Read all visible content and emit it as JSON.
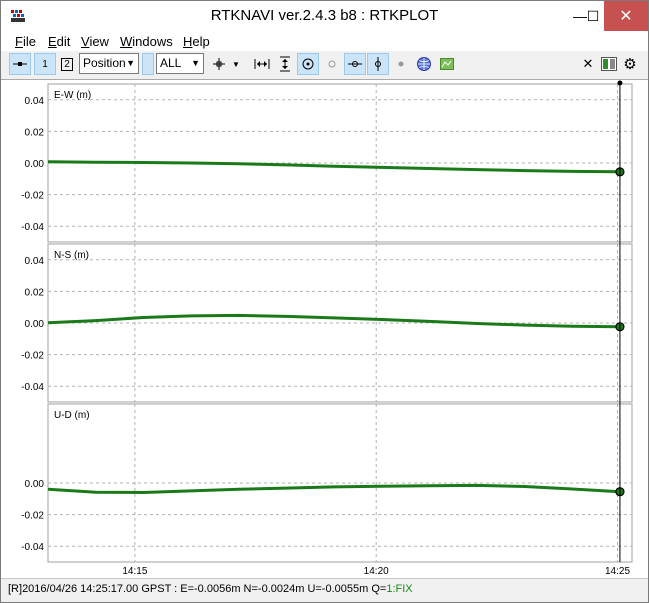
{
  "window": {
    "title": "RTKNAVI ver.2.4.3 b8 : RTKPLOT",
    "minimize_glyph": "—",
    "maximize_glyph": "☐",
    "close_glyph": "✕"
  },
  "menu": [
    {
      "label": "File",
      "accel": "F",
      "rest": "ile"
    },
    {
      "label": "Edit",
      "accel": "E",
      "rest": "dit"
    },
    {
      "label": "View",
      "accel": "V",
      "rest": "iew"
    },
    {
      "label": "Windows",
      "accel": "W",
      "rest": "indows"
    },
    {
      "label": "Help",
      "accel": "H",
      "rest": "elp"
    }
  ],
  "toolbar": {
    "btn1_label": "1",
    "btn2_label": "2",
    "plot_type": "Position",
    "sat_filter": "ALL",
    "icons": [
      "solution-1-icon",
      "solution-2-icon",
      "center-icon",
      "fit-horizontal-icon",
      "fit-vertical-icon",
      "center-origin-icon",
      "show-map-icon",
      "skyplot-icon",
      "google-earth-icon",
      "close-icon",
      "layout-icon",
      "gear-icon"
    ]
  },
  "colors": {
    "series": "#1a7a1a",
    "grid": "#b0b0b0",
    "axis_frame": "#a0a0a0",
    "fix_status": "#1a8a1a"
  },
  "chart_data": {
    "type": "line",
    "panels": [
      {
        "ylabel": "E-W (m)",
        "ylim": [
          -0.05,
          0.05
        ],
        "yticks": [
          "0.04",
          "0.02",
          "0.00",
          "-0.02",
          "-0.04"
        ],
        "ytick_values": [
          0.04,
          0.02,
          0.0,
          -0.02,
          -0.04
        ],
        "values": [
          0.0008,
          0.0005,
          0.0003,
          0.0,
          -0.0005,
          -0.0012,
          -0.002,
          -0.0028,
          -0.0035,
          -0.0042,
          -0.0048,
          -0.0053,
          -0.0056
        ]
      },
      {
        "ylabel": "N-S (m)",
        "ylim": [
          -0.05,
          0.05
        ],
        "yticks": [
          "0.04",
          "0.02",
          "0.00",
          "-0.02",
          "-0.04"
        ],
        "ytick_values": [
          0.04,
          0.02,
          0.0,
          -0.02,
          -0.04
        ],
        "values": [
          0.0002,
          0.0015,
          0.0035,
          0.0045,
          0.0048,
          0.0042,
          0.0032,
          0.0022,
          0.001,
          -0.0003,
          -0.0013,
          -0.002,
          -0.0024
        ]
      },
      {
        "ylabel": "U-D (m)",
        "ylim": [
          -0.05,
          0.05
        ],
        "yticks": [
          "0.00",
          "-0.02",
          "-0.04"
        ],
        "ytick_values": [
          0.0,
          -0.02,
          -0.04
        ],
        "values": [
          -0.004,
          -0.0058,
          -0.006,
          -0.005,
          -0.004,
          -0.0032,
          -0.0025,
          -0.002,
          -0.0018,
          -0.0015,
          -0.0022,
          -0.0038,
          -0.0055
        ]
      }
    ],
    "x_tick_labels": [
      "14:15",
      "14:20",
      "14:25"
    ],
    "x_tick_minutes": [
      15,
      20,
      25
    ],
    "xlim_minutes": [
      13.2,
      25.3
    ],
    "grid": true
  },
  "status": {
    "prefix": "[R]",
    "text": "2016/04/26 14:25:17.00 GPST : E=-0.0056m N=-0.0024m U=-0.0055m Q=",
    "quality": "1:FIX"
  }
}
